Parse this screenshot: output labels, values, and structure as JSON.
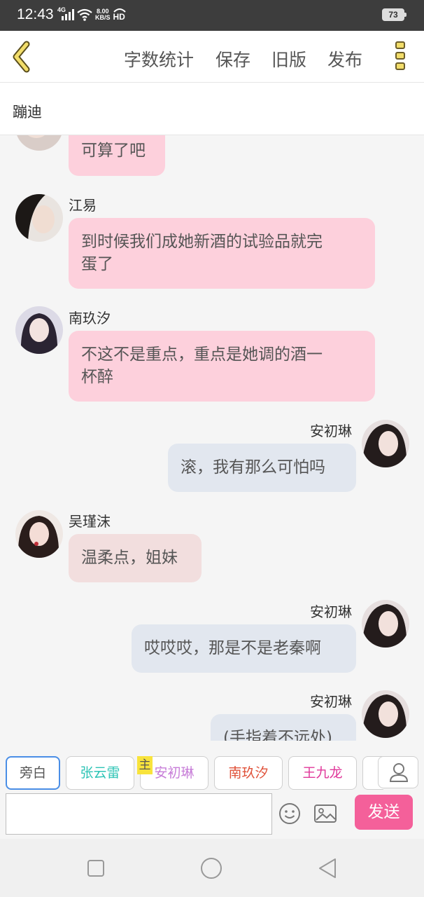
{
  "status_bar": {
    "time": "12:43",
    "network_type": "4G",
    "speed_value": "8.00",
    "speed_unit": "KB/S",
    "hd": "HD",
    "battery": "73"
  },
  "header": {
    "back_icon": "chevron-left-icon",
    "word_count_label": "字数统计",
    "save_label": "保存",
    "old_version_label": "旧版",
    "publish_label": "发布",
    "menu_icon": "vertical-dots-icon",
    "accent_color": "#f2dd6a"
  },
  "story_title": "蹦迪",
  "messages": [
    {
      "side": "left",
      "name": "",
      "text": "可算了吧",
      "color": "#fdd0dc"
    },
    {
      "side": "left",
      "name": "江易",
      "text_lines": [
        "到时候我们成她新酒的试验品就完",
        "蛋了"
      ],
      "color": "#fdd0dc"
    },
    {
      "side": "left",
      "name": "南玖汐",
      "text_lines": [
        "不这不是重点，重点是她调的酒一",
        "杯醉"
      ],
      "color": "#fdd0dc"
    },
    {
      "side": "right",
      "name": "安初琳",
      "text": "滚，我有那么可怕吗",
      "color": "#e2e7ef"
    },
    {
      "side": "left",
      "name": "吴瑾沫",
      "text": "温柔点，姐妹",
      "color": "#f2dede"
    },
    {
      "side": "right",
      "name": "安初琳",
      "text": "哎哎哎，那是不是老秦啊",
      "color": "#e2e7ef"
    },
    {
      "side": "right",
      "name": "安初琳",
      "text": "(手指着不远处)",
      "color": "#e2e7ef"
    }
  ],
  "characters": [
    {
      "label": "旁白",
      "color": "#555555",
      "selected": true
    },
    {
      "label": "张云雷",
      "color": "#2ec4b6",
      "selected": false
    },
    {
      "label": "安初琳",
      "color": "#c77dd8",
      "selected": false,
      "tag": "主"
    },
    {
      "label": "南玖汐",
      "color": "#e0523a",
      "selected": false
    },
    {
      "label": "王九龙",
      "color": "#e0389a",
      "selected": false
    }
  ],
  "composer": {
    "input_value": "",
    "emoji_icon": "smiley-icon",
    "image_icon": "image-icon",
    "person_icon": "person-icon",
    "send_label": "发送",
    "send_color": "#f4609a"
  },
  "nav_bar": {
    "recents_icon": "square-icon",
    "home_icon": "circle-icon",
    "back_icon": "triangle-back-icon"
  }
}
